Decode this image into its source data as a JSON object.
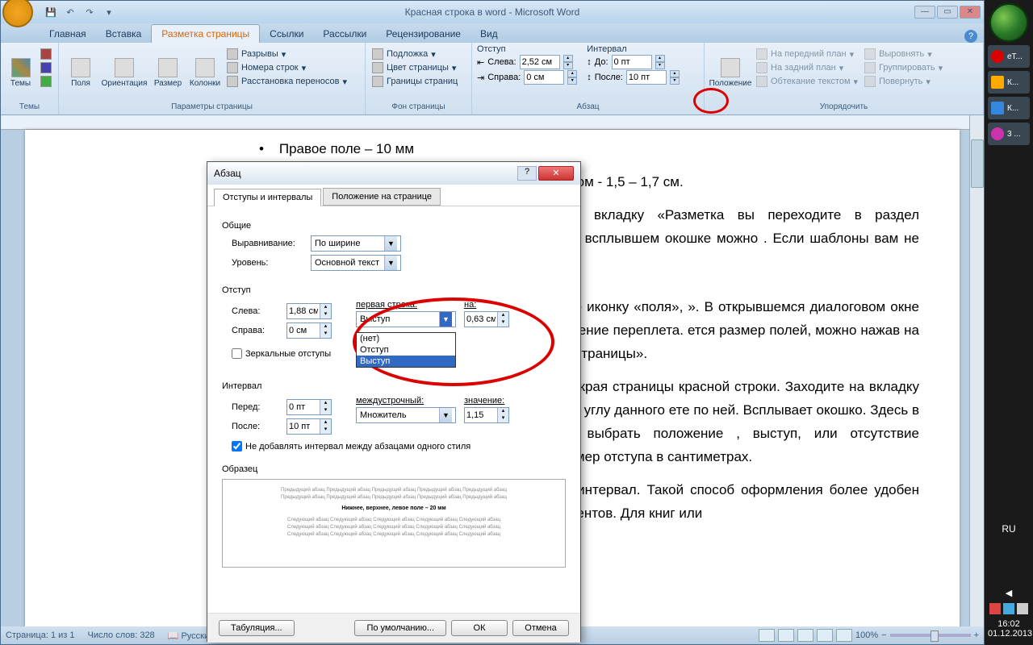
{
  "window": {
    "title": "Красная строка в word - Microsoft Word"
  },
  "tabs": {
    "home": "Главная",
    "insert": "Вставка",
    "page_layout": "Разметка страницы",
    "references": "Ссылки",
    "mailings": "Рассылки",
    "review": "Рецензирование",
    "view": "Вид"
  },
  "ribbon": {
    "themes": {
      "label": "Темы",
      "btn": "Темы"
    },
    "page_setup": {
      "label": "Параметры страницы",
      "margins": "Поля",
      "orientation": "Ориентация",
      "size": "Размер",
      "columns": "Колонки",
      "breaks": "Разрывы",
      "line_numbers": "Номера строк",
      "hyphenation": "Расстановка переносов"
    },
    "page_bg": {
      "label": "Фон страницы",
      "watermark": "Подложка",
      "page_color": "Цвет страницы",
      "page_borders": "Границы страниц"
    },
    "paragraph": {
      "label": "Абзац",
      "indent": "Отступ",
      "left": "Слева:",
      "right": "Справа:",
      "left_val": "2,52 см",
      "right_val": "0 см",
      "spacing": "Интервал",
      "before": "До:",
      "after": "После:",
      "before_val": "0 пт",
      "after_val": "10 пт"
    },
    "arrange": {
      "label": "Упорядочить",
      "position": "Положение",
      "bring_front": "На передний план",
      "send_back": "На задний план",
      "text_wrap": "Обтекание текстом",
      "align": "Выровнять",
      "group": "Группировать",
      "rotate": "Повернуть"
    }
  },
  "document": {
    "bullet": "Правое поле – 10 мм",
    "line1": "Отступ в красной строке может быть разным, в основном  - 1,5 – 1,7 см.",
    "p1": "007 следует отрыть вкладку «Разметка вы переходите в раздел «Параметры оля». Во всплывшем окошке можно . Если шаблоны вам не подходят, то",
    "p2": "ы страницы» кликаете иконку «поля», ». В открывшемся диалоговом окне жно указать расположение переплета. ется размер полей, можно нажав на раздела «параметры страницы».",
    "p3": "значения отступов от края страницы красной строки. Заходите на вкладку ац». В правом нижнем углу данного ете по ней. Всплывает окошко. Здесь в ока». Здесь можно выбрать положение , выступ, или отсутствие изменений. одите размер отступа в сантиметрах.",
    "p4": "ежду абзацами есть интервал.  Такой способ оформления более удобен для небольших документов. Для книг или"
  },
  "dialog": {
    "title": "Абзац",
    "tab1": "Отступы и интервалы",
    "tab2": "Положение на странице",
    "general": "Общие",
    "alignment": "Выравнивание:",
    "alignment_val": "По ширине",
    "outline": "Уровень:",
    "outline_val": "Основной текст",
    "indent": "Отступ",
    "left": "Слева:",
    "left_val": "1,88 см",
    "right": "Справа:",
    "right_val": "0 см",
    "mirror": "Зеркальные отступы",
    "first_line": "первая строка:",
    "first_line_val": "Выступ",
    "by": "на:",
    "by_val": "0,63 см",
    "dd_none": "(нет)",
    "dd_indent": "Отступ",
    "dd_hanging": "Выступ",
    "spacing": "Интервал",
    "before": "Перед:",
    "before_val": "0 пт",
    "after": "После:",
    "after_val": "10 пт",
    "line_spacing": "междустрочный:",
    "line_spacing_val": "Множитель",
    "at": "значение:",
    "at_val": "1,15",
    "no_space": "Не добавлять интервал между абзацами одного стиля",
    "preview": "Образец",
    "preview_text": "Предыдущий абзац Предыдущий абзац Предыдущий абзац Предыдущий абзац Предыдущий абзац",
    "preview_bold": "Нижнее, верхнее, левое поле – 20 мм",
    "preview_next": "Следующий абзац Следующий абзац Следующий абзац Следующий абзац Следующий абзац",
    "tabs_btn": "Табуляция...",
    "default_btn": "По умолчанию...",
    "ok": "ОК",
    "cancel": "Отмена"
  },
  "statusbar": {
    "page": "Страница: 1 из 1",
    "words": "Число слов: 328",
    "lang": "Русский (Россия)",
    "zoom": "100%"
  },
  "taskbar": {
    "yandex": "eT...",
    "k1": "К...",
    "k2": "К...",
    "three": "3 ...",
    "lang": "RU",
    "time": "16:02",
    "date": "01.12.2013"
  }
}
